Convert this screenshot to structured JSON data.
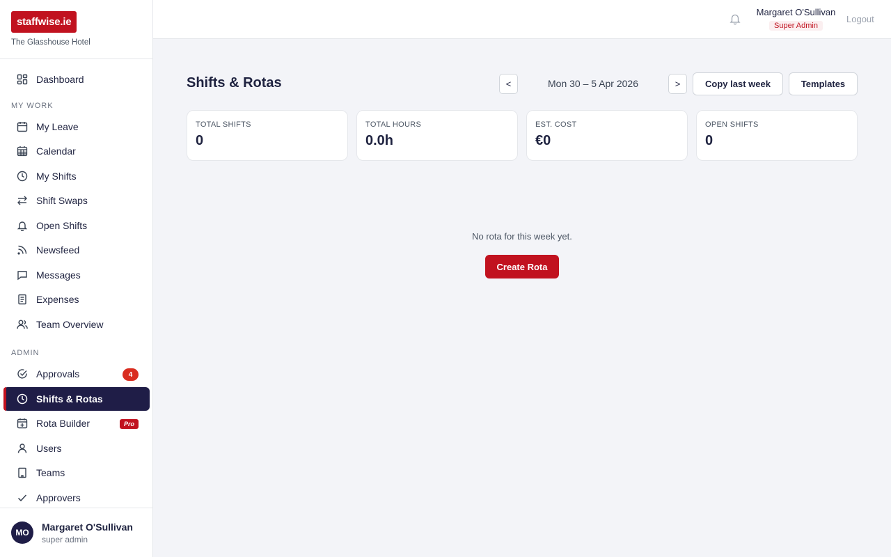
{
  "brand": {
    "logo": "staffwise.ie",
    "org": "The Glasshouse Hotel"
  },
  "sidebar": {
    "dashboard": "Dashboard",
    "section_my_work": "MY WORK",
    "my_work": [
      "My Leave",
      "Calendar",
      "My Shifts",
      "Shift Swaps",
      "Open Shifts",
      "Newsfeed",
      "Messages",
      "Expenses",
      "Team Overview"
    ],
    "section_admin": "ADMIN",
    "admin": [
      "Approvals",
      "Shifts & Rotas",
      "Rota Builder",
      "Users",
      "Teams",
      "Approvers"
    ],
    "approvals_badge": "4",
    "rota_builder_badge": "Pro",
    "active_item": "Shifts & Rotas"
  },
  "footer_user": {
    "initials": "MO",
    "name": "Margaret O'Sullivan",
    "role": "super admin"
  },
  "topbar": {
    "user_name": "Margaret O'Sullivan",
    "user_role": "Super Admin",
    "logout": "Logout"
  },
  "header": {
    "title": "Shifts & Rotas",
    "prev": "<",
    "week": "Mon 30 – 5 Apr 2026",
    "next": ">",
    "copy_last_week": "Copy last week",
    "templates": "Templates"
  },
  "stats": [
    {
      "label": "TOTAL SHIFTS",
      "value": "0"
    },
    {
      "label": "TOTAL HOURS",
      "value": "0.0h"
    },
    {
      "label": "EST. COST",
      "value": "€0"
    },
    {
      "label": "OPEN SHIFTS",
      "value": "0"
    }
  ],
  "empty_state": {
    "message": "No rota for this week yet.",
    "button": "Create Rota"
  },
  "colors": {
    "brand_red": "#c1121f",
    "navy": "#1f1d47",
    "background": "#f3f4f8"
  }
}
